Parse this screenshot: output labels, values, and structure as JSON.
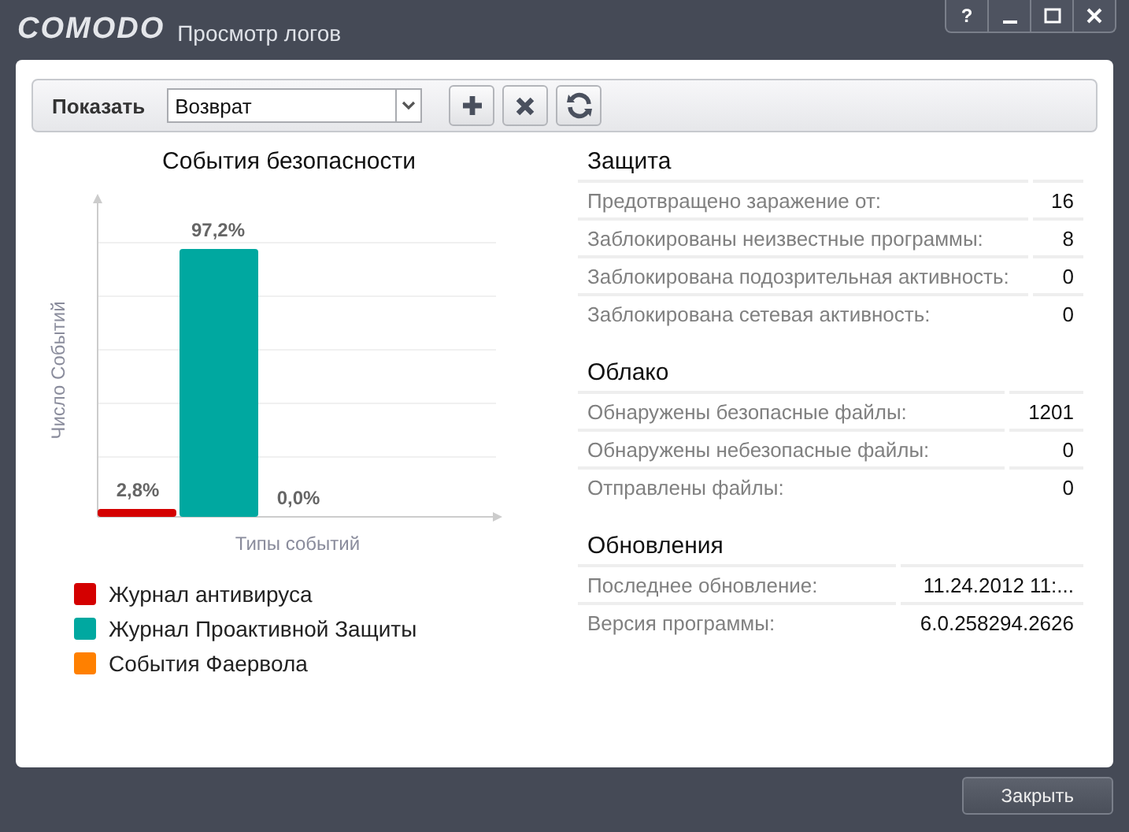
{
  "window": {
    "logo": "COMODO",
    "title": "Просмотр логов",
    "controls": [
      "?"
    ]
  },
  "toolbar": {
    "label": "Показать",
    "dropdown": {
      "value": "Возврат"
    }
  },
  "chart": {
    "title": "События безопасности",
    "xlabel": "Типы событий",
    "ylabel": "Число Событий",
    "bar_labels": [
      "2,8%",
      "97,2%",
      "0,0%"
    ],
    "legend": [
      {
        "label": "Журнал антивируса",
        "color": "#d40000"
      },
      {
        "label": "Журнал Проактивной Защиты",
        "color": "#00a8a0"
      },
      {
        "label": "События Фаервола",
        "color": "#ff8000"
      }
    ]
  },
  "sections": [
    {
      "title": "Защита",
      "rows": [
        {
          "label": "Предотвращено заражение от:",
          "value": "16"
        },
        {
          "label": "Заблокированы неизвестные программы:",
          "value": "8"
        },
        {
          "label": "Заблокирована подозрительная активность:",
          "value": "0"
        },
        {
          "label": "Заблокирована сетевая активность:",
          "value": "0"
        }
      ]
    },
    {
      "title": "Облако",
      "rows": [
        {
          "label": "Обнаружены безопасные файлы:",
          "value": "1201"
        },
        {
          "label": "Обнаружены небезопасные файлы:",
          "value": "0"
        },
        {
          "label": "Отправлены файлы:",
          "value": "0"
        }
      ]
    },
    {
      "title": "Обновления",
      "rows": [
        {
          "label": "Последнее обновление:",
          "value": "11.24.2012 11:..."
        },
        {
          "label": "Версия программы:",
          "value": "6.0.258294.2626"
        }
      ]
    }
  ],
  "footer": {
    "button": "Закрыть"
  }
}
